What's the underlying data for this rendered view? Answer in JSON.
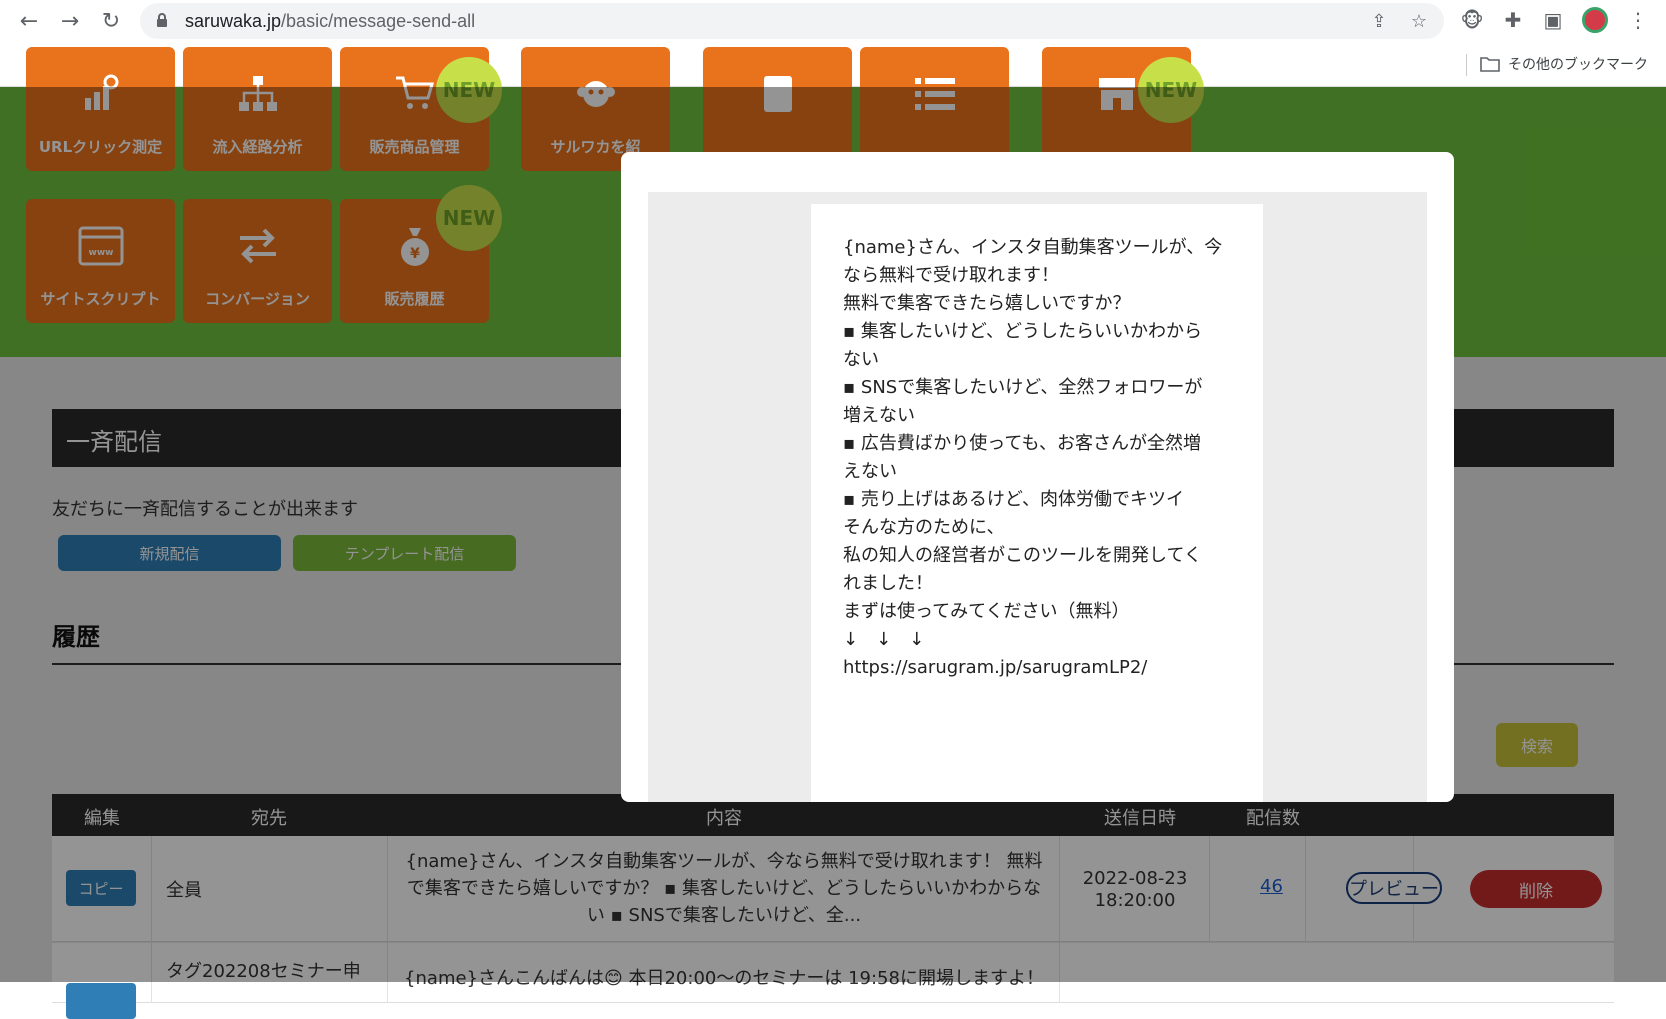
{
  "browser": {
    "url_domain": "saruwaka.jp",
    "url_path": "/basic/message-send-all",
    "bookmark_folder": "その他のブックマーク"
  },
  "tiles": [
    {
      "label": "URLクリック測定",
      "icon": "chart-search-icon"
    },
    {
      "label": "流入経路分析",
      "icon": "hierarchy-icon"
    },
    {
      "label": "販売商品管理",
      "icon": "cart-icon",
      "new": "NEW"
    },
    {
      "label": "サルワカを紹",
      "icon": "monkey-icon"
    },
    {
      "label": "",
      "icon": "book-icon"
    },
    {
      "label": "",
      "icon": "list-icon"
    },
    {
      "label": "",
      "icon": "store-icon",
      "new": "NEW"
    },
    {
      "label": "サイトスクリプト",
      "icon": "browser-icon"
    },
    {
      "label": "コンバージョン",
      "icon": "exchange-icon"
    },
    {
      "label": "販売履歴",
      "icon": "money-bag-icon",
      "new": "NEW"
    }
  ],
  "section": {
    "title": "一斉配信",
    "description": "友だちに一斉配信することが出来ます",
    "new_button": "新規配信",
    "template_button": "テンプレート配信"
  },
  "history": {
    "title": "履歴",
    "search_button": "検索",
    "columns": [
      "編集",
      "宛先",
      "内容",
      "送信日時",
      "配信数"
    ],
    "rows": [
      {
        "edit": "コピー",
        "recipient": "全員",
        "content_l1": "{name}さん、インスタ自動集客ツールが、今なら無料で受け取れます！ 無料",
        "content_l2": "で集客できたら嬉しいですか？ ▪ 集客したいけど、どうしたらいいかわからな",
        "content_l3": "い ▪ SNSで集客したいけど、全...",
        "date": "2022-08-23",
        "time": "18:20:00",
        "count": "46",
        "preview": "プレビュー",
        "delete": "削除"
      },
      {
        "recipient": "タグ202208セミナー申",
        "content_l1": "{name}さんこんばんは😊 本日20:00〜のセミナーは 19:58に開場しますよ！"
      }
    ]
  },
  "modal": {
    "lines": [
      "{name}さん、インスタ自動集客ツールが、今",
      "なら無料で受け取れます！",
      "",
      "無料で集客できたら嬉しいですか？",
      "",
      "▪ 集客したいけど、どうしたらいいかわから",
      "ない",
      "▪ SNSで集客したいけど、全然フォロワーが",
      "増えない",
      "▪ 広告費ばかり使っても、お客さんが全然増",
      "えない",
      "▪ 売り上げはあるけど、肉体労働でキツイ",
      "",
      "そんな方のために、",
      "私の知人の経営者がこのツールを開発してく",
      "れました！",
      "",
      "まずは使ってみてください（無料）",
      "↓　↓　↓",
      "https://sarugram.jp/sarugramLP2/"
    ]
  },
  "colors": {
    "green_header": "#6fc23d",
    "tile_orange": "#e8731c",
    "new_badge": "#c7e04a",
    "primary_blue": "#2f7fb6",
    "template_green": "#7ab83a",
    "delete_red": "#c52c2c"
  }
}
